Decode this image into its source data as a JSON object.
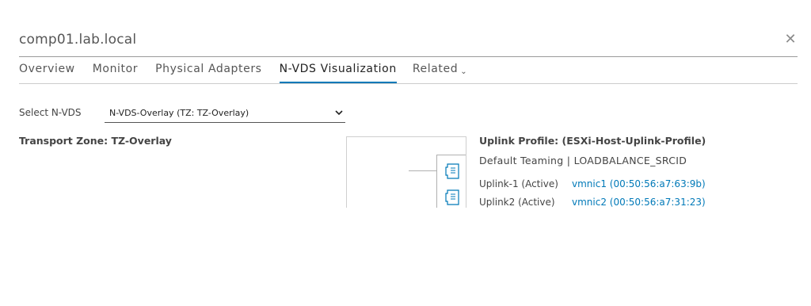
{
  "window": {
    "title": "comp01.lab.local",
    "close_icon": "close-icon"
  },
  "tabs": [
    {
      "label": "Overview",
      "active": false
    },
    {
      "label": "Monitor",
      "active": false
    },
    {
      "label": "Physical Adapters",
      "active": false
    },
    {
      "label": "N-VDS Visualization",
      "active": true
    },
    {
      "label": "Related",
      "active": false,
      "has_dropdown": true
    }
  ],
  "select": {
    "label": "Select N-VDS",
    "value": "N-VDS-Overlay (TZ: TZ-Overlay)"
  },
  "transport_zone": {
    "label": "Transport Zone: TZ-Overlay"
  },
  "uplink_profile": {
    "title": "Uplink Profile: (ESXi-Host-Uplink-Profile)",
    "teaming": "Default Teaming | LOADBALANCE_SRCID",
    "uplinks": [
      {
        "name": "Uplink-1 (Active)",
        "vmnic": "vmnic1 (00:50:56:a7:63:9b)"
      },
      {
        "name": "Uplink2 (Active)",
        "vmnic": "vmnic2 (00:50:56:a7:31:23)"
      }
    ]
  },
  "colors": {
    "accent": "#0079b8",
    "text": "#444444"
  }
}
